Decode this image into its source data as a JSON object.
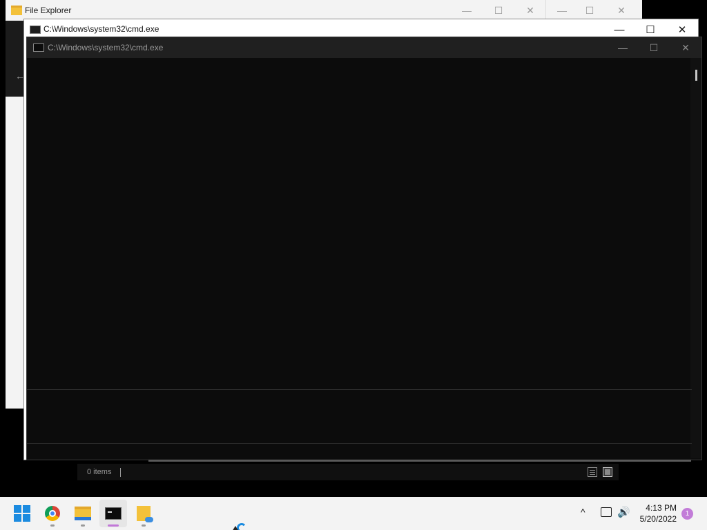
{
  "file_explorer": {
    "title": "File Explorer",
    "caption": {
      "minimize": "—",
      "maximize": "☐",
      "close": "✕"
    },
    "back": "←",
    "status": {
      "items": "0 items"
    }
  },
  "ghost_window": {
    "caption": {
      "minimize": "—",
      "maximize": "☐",
      "close": "✕"
    }
  },
  "cmd_window_back": {
    "title": "C:\\Windows\\system32\\cmd.exe",
    "caption": {
      "minimize": "—",
      "maximize": "☐",
      "close": "✕"
    }
  },
  "cmd_window_front": {
    "title": "C:\\Windows\\system32\\cmd.exe",
    "caption": {
      "minimize": "—",
      "maximize": "☐",
      "close": "✕"
    },
    "content": ""
  },
  "taskbar": {
    "apps": [
      {
        "name": "Start",
        "icon": "windows-logo-icon"
      },
      {
        "name": "Google Chrome",
        "icon": "chrome-icon"
      },
      {
        "name": "File Explorer",
        "icon": "folder-icon"
      },
      {
        "name": "Command Prompt",
        "icon": "cmd-icon"
      },
      {
        "name": "Folder",
        "icon": "folder-cloud-icon"
      }
    ],
    "tray": {
      "chevron": "^",
      "volume": "🔊",
      "time": "4:13 PM",
      "date": "5/20/2022",
      "notifications": "1"
    }
  },
  "colors": {
    "terminal_bg": "#0c0c0c",
    "titlebar_dark": "#202020",
    "taskbar_bg": "#f3f3f3",
    "accent": "#1b8be0",
    "notification": "#c27cd8"
  }
}
